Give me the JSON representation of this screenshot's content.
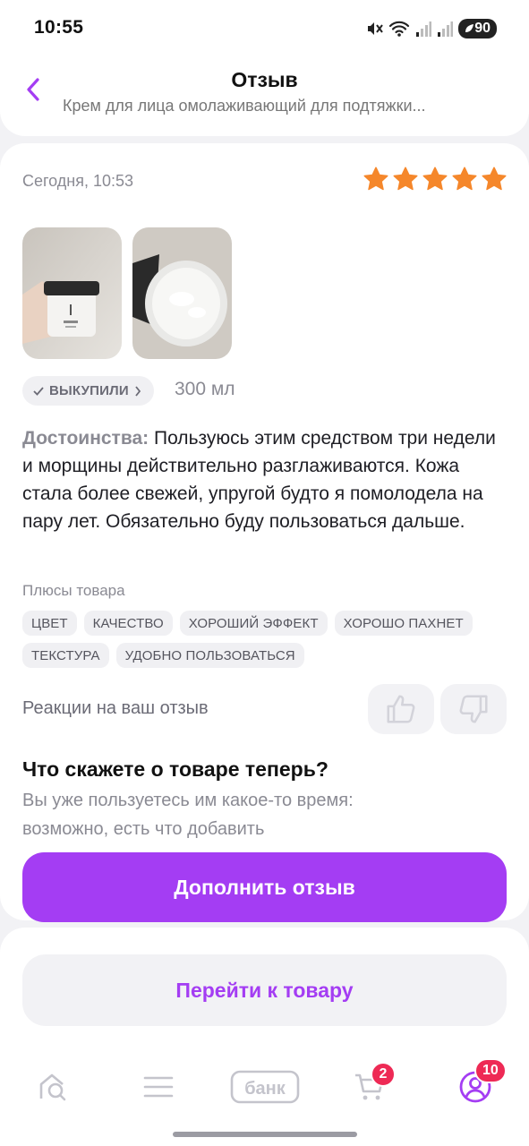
{
  "status_bar": {
    "time": "10:55",
    "battery": "90",
    "icons": [
      "mute-icon",
      "wifi-icon",
      "signal-icon",
      "signal-icon"
    ]
  },
  "header": {
    "title": "Отзыв",
    "subtitle": "Крем для лица омолаживающий для подтяжки...",
    "back_icon": "chevron-left-icon"
  },
  "review": {
    "date": "Сегодня, 10:53",
    "rating": 5,
    "rating_max": 5,
    "photos": [
      "photo-jar-closed",
      "photo-jar-open"
    ],
    "bought_label": "ВЫКУПИЛИ",
    "volume": "300 мл",
    "text_label": "Достоинства:",
    "text": "Пользуюсь этим средством три недели и морщины действительно разглаживаются. Кожа стала более свежей, упругой будто я помолодела на пару лет. Обязательно буду пользоваться дальше.",
    "pros_title": "Плюсы товара",
    "tags": [
      "ЦВЕТ",
      "КАЧЕСТВО",
      "ХОРОШИЙ ЭФФЕКТ",
      "ХОРОШО ПАХНЕТ",
      "ТЕКСТУРА",
      "УДОБНО ПОЛЬЗОВАТЬСЯ"
    ],
    "reactions_label": "Реакции на ваш отзыв"
  },
  "followup": {
    "title": "Что скажете о товаре теперь?",
    "subtitle": "Вы уже пользуетесь им какое-то время: возможно, есть что добавить",
    "button": "Дополнить отзыв"
  },
  "go_to_product": "Перейти к товару",
  "bottom_nav": {
    "bank_label": "банк",
    "cart_badge": "2",
    "profile_badge": "10"
  },
  "colors": {
    "accent": "#a43df3",
    "star": "#f5872b",
    "badge": "#ee2a55"
  }
}
